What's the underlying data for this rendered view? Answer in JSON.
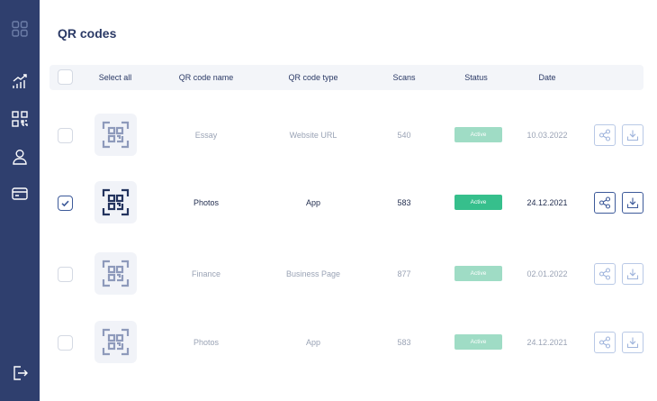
{
  "sidebar": {
    "items": [
      {
        "icon": "dashboard-grid-icon"
      },
      {
        "icon": "analytics-chart-icon"
      },
      {
        "icon": "qr-code-icon"
      },
      {
        "icon": "user-icon"
      },
      {
        "icon": "credit-card-icon"
      },
      {
        "icon": "logout-icon"
      }
    ]
  },
  "page": {
    "title": "QR codes"
  },
  "table": {
    "columns": {
      "select_all": "Select all",
      "name": "QR code name",
      "type": "QR code type",
      "scans": "Scans",
      "status": "Status",
      "date": "Date"
    },
    "rows": [
      {
        "name": "Essay",
        "type": "Website URL",
        "scans": "540",
        "status": "Active",
        "date": "10.03.2022",
        "selected": false
      },
      {
        "name": "Photos",
        "type": "App",
        "scans": "583",
        "status": "Active",
        "date": "24.12.2021",
        "selected": true
      },
      {
        "name": "Finance",
        "type": "Business Page",
        "scans": "877",
        "status": "Active",
        "date": "02.01.2022",
        "selected": false
      },
      {
        "name": "Photos",
        "type": "App",
        "scans": "583",
        "status": "Active",
        "date": "24.12.2021",
        "selected": false
      }
    ]
  },
  "colors": {
    "sidebar_bg": "#2f3f6e",
    "title": "#2b3a66",
    "status_active": "#36bf8c",
    "status_muted": "#9fdcc5",
    "accent": "#3d5a9a"
  }
}
